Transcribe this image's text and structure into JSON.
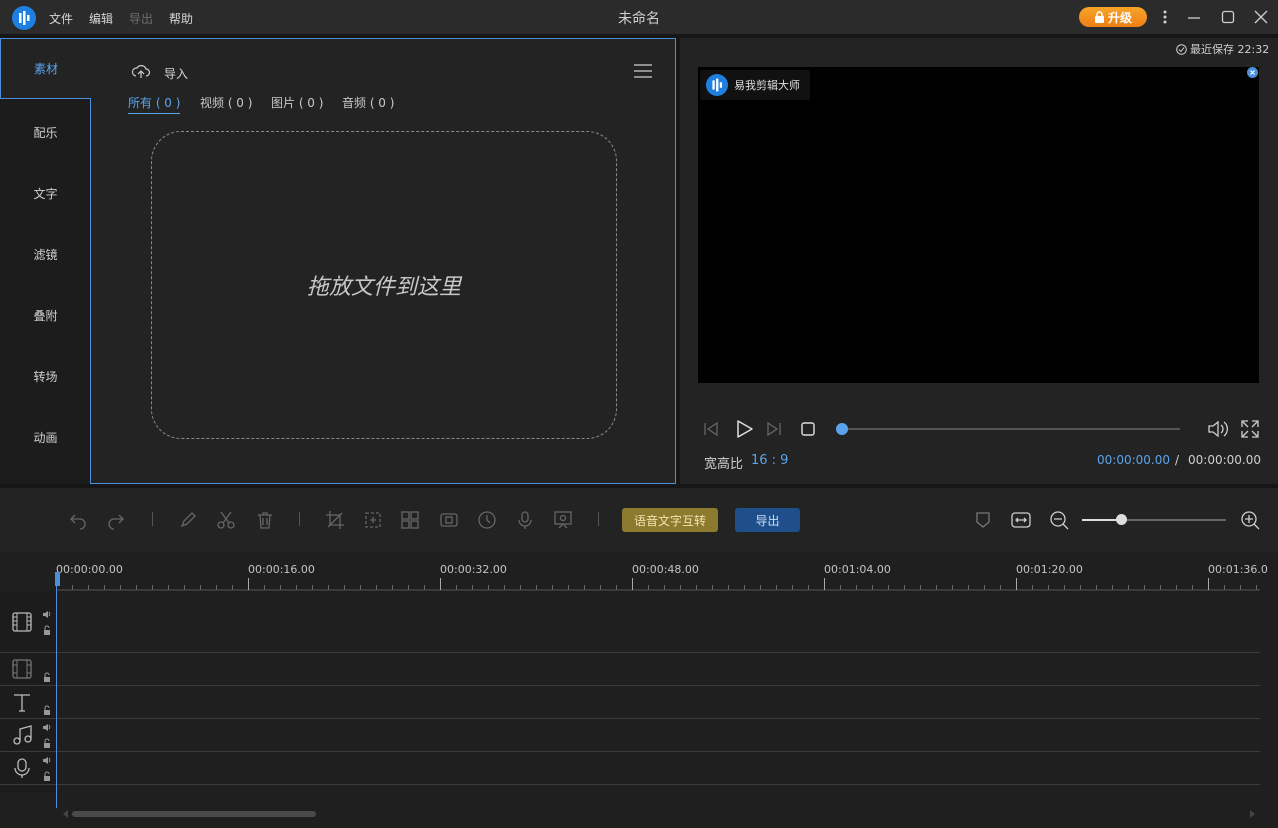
{
  "app": {
    "title": "未命名",
    "menu": [
      "文件",
      "编辑",
      "导出",
      "帮助"
    ],
    "upgrade_label": "升级"
  },
  "side_tabs": [
    "素材",
    "配乐",
    "文字",
    "滤镜",
    "叠附",
    "转场",
    "动画"
  ],
  "media": {
    "import_label": "导入",
    "filters": [
      "所有 ( 0 )",
      "视频 ( 0 )",
      "图片 ( 0 )",
      "音频 ( 0 )"
    ],
    "drop_text": "拖放文件到这里"
  },
  "preview": {
    "last_saved": "最近保存 22:32",
    "badge_text": "易我剪辑大师",
    "aspect_label": "宽高比",
    "aspect_value": "16 : 9",
    "current_time": "00:00:00.00",
    "time_sep": "/",
    "total_time": "00:00:00.00",
    "progress": 0
  },
  "timeline": {
    "voice_btn": "语音文字互转",
    "export_btn": "导出",
    "zoom_level": 0.28,
    "ruler_labels": [
      "00:00:00.00",
      "00:00:16.00",
      "00:00:32.00",
      "00:00:48.00",
      "00:01:04.00",
      "00:01:20.00",
      "00:01:36.0"
    ]
  },
  "colors": {
    "accent": "#5aa4ec",
    "upgrade": "#f0901e",
    "voice_btn": "#8c7a2e",
    "export_btn": "#1e4f8a"
  }
}
